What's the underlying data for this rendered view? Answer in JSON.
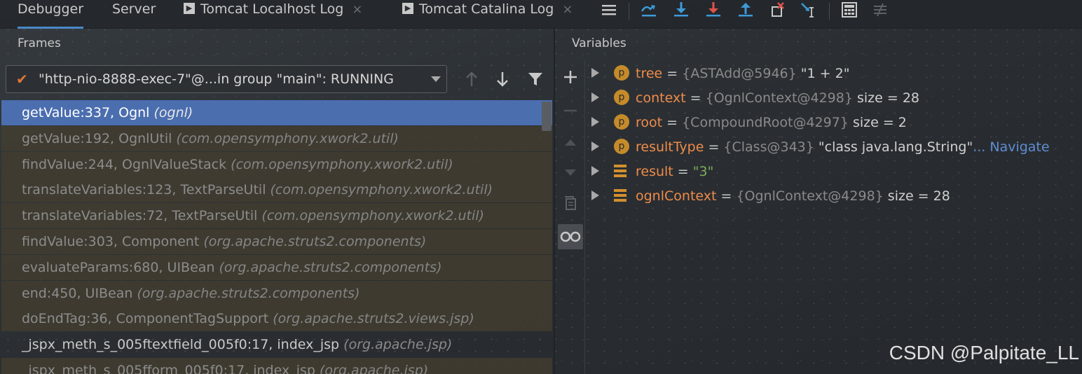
{
  "tabs": [
    {
      "label": "Debugger"
    },
    {
      "label": "Server"
    },
    {
      "label": "Tomcat Localhost Log",
      "close": "×"
    },
    {
      "label": "Tomcat Catalina Log",
      "close": "×"
    }
  ],
  "toolbar": {
    "icons": [
      "hamburger-icon",
      "show-execution-point-icon",
      "step-over-icon",
      "step-into-icon",
      "force-step-into-icon",
      "step-out-icon",
      "drop-frame-icon",
      "run-to-cursor-icon",
      "evaluate-expression-icon",
      "trace-icon"
    ]
  },
  "frames": {
    "header": "Frames",
    "thread_selector": "\"http-nio-8888-exec-7\"@...in group \"main\": RUNNING",
    "rows": [
      {
        "method": "getValue:337, Ognl ",
        "pkg": "(ognl)",
        "style": "sel"
      },
      {
        "method": "getValue:192, OgnlUtil ",
        "pkg": "(com.opensymphony.xwork2.util)",
        "style": "lib"
      },
      {
        "method": "findValue:244, OgnlValueStack ",
        "pkg": "(com.opensymphony.xwork2.util)",
        "style": "lib"
      },
      {
        "method": "translateVariables:123, TextParseUtil ",
        "pkg": "(com.opensymphony.xwork2.util)",
        "style": "lib"
      },
      {
        "method": "translateVariables:72, TextParseUtil ",
        "pkg": "(com.opensymphony.xwork2.util)",
        "style": "lib"
      },
      {
        "method": "findValue:303, Component ",
        "pkg": "(org.apache.struts2.components)",
        "style": "lib"
      },
      {
        "method": "evaluateParams:680, UIBean ",
        "pkg": "(org.apache.struts2.components)",
        "style": "lib"
      },
      {
        "method": "end:450, UIBean ",
        "pkg": "(org.apache.struts2.components)",
        "style": "lib"
      },
      {
        "method": "doEndTag:36, ComponentTagSupport ",
        "pkg": "(org.apache.struts2.views.jsp)",
        "style": "lib"
      },
      {
        "method": "_jspx_meth_s_005ftextfield_005f0:17, index_jsp ",
        "pkg": "(org.apache.jsp)",
        "style": "plain"
      },
      {
        "method": "_jspx_meth_s_005fform_005f0:17, index_jsp ",
        "pkg": "(org.apache.jsp)",
        "style": "lib"
      }
    ]
  },
  "variables": {
    "header": "Variables",
    "rows": [
      {
        "badge": "p",
        "name": "tree",
        "eq": " = ",
        "type": "{ASTAdd@5946}",
        "value": " \"1 + 2\"",
        "extra": ""
      },
      {
        "badge": "p",
        "name": "context",
        "eq": " = ",
        "type": "{OgnlContext@4298}",
        "value": "  size = 28",
        "extra": ""
      },
      {
        "badge": "p",
        "name": "root",
        "eq": " = ",
        "type": "{CompoundRoot@4297}",
        "value": "  size = 2",
        "extra": ""
      },
      {
        "badge": "p",
        "name": "resultType",
        "eq": " = ",
        "type": "{Class@343}",
        "value": " \"class java.lang.String\"",
        "extra": "... Navigate"
      },
      {
        "badge": "list",
        "name": "result",
        "eq": " = ",
        "type": "",
        "value": "\"3\"",
        "extra": ""
      },
      {
        "badge": "list",
        "name": "ognlContext",
        "eq": " = ",
        "type": "{OgnlContext@4298}",
        "value": "  size = 28",
        "extra": ""
      }
    ]
  },
  "watermark": "CSDN @Palpitate_LL"
}
